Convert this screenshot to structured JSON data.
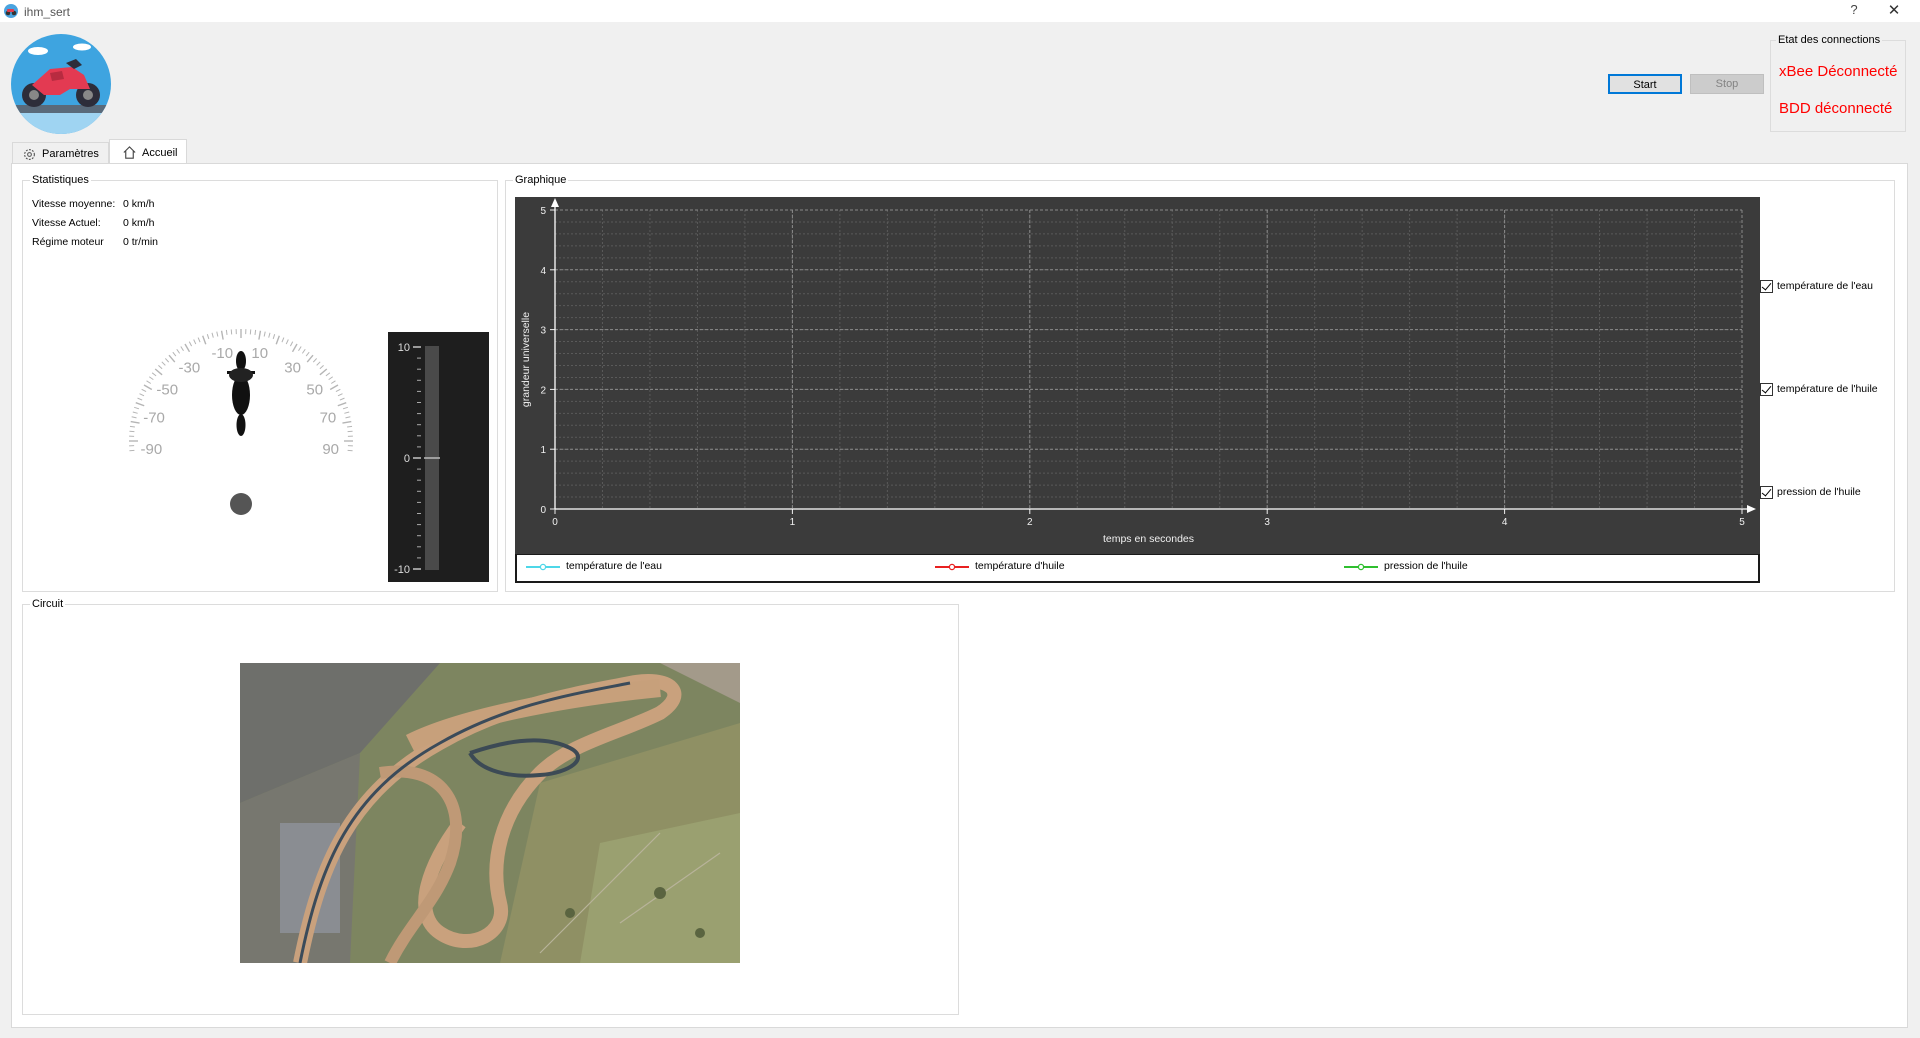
{
  "window": {
    "title": "ihm_sert",
    "help_glyph": "?",
    "close_glyph": "✕"
  },
  "toolbar": {
    "start_label": "Start",
    "stop_label": "Stop"
  },
  "connections": {
    "title": "Etat des connections",
    "xbee": "xBee Déconnecté",
    "bdd": "BDD déconnecté",
    "status_color": "#ff0000"
  },
  "tabs": [
    {
      "label": "Paramètres",
      "icon": "gear-icon",
      "active": false
    },
    {
      "label": "Accueil",
      "icon": "home-icon",
      "active": true
    }
  ],
  "stats": {
    "title": "Statistiques",
    "rows": [
      {
        "label": "Vitesse moyenne:",
        "value": "0 km/h"
      },
      {
        "label": "Vitesse Actuel:",
        "value": "0 km/h"
      },
      {
        "label": "Régime moteur",
        "value": "0 tr/min"
      }
    ]
  },
  "gauge": {
    "ticks": [
      "-90",
      "-70",
      "-50",
      "-30",
      "-10",
      "10",
      "30",
      "50",
      "70",
      "90"
    ],
    "value": 0,
    "icon": "motorcycle-icon"
  },
  "slider": {
    "ticks": [
      "10",
      "0",
      "-10"
    ],
    "value": 0,
    "min": -10,
    "max": 10
  },
  "graph": {
    "title": "Graphique",
    "checkboxes": [
      {
        "label": "température de l'eau",
        "checked": true
      },
      {
        "label": "température de l'huile",
        "checked": true
      },
      {
        "label": "pression de l'huile",
        "checked": true
      }
    ],
    "legend": [
      {
        "name": "température de l'eau",
        "color": "#4dd7e8"
      },
      {
        "name": "température d'huile",
        "color": "#e82020"
      },
      {
        "name": "pression de l'huile",
        "color": "#2fbf2f"
      }
    ]
  },
  "chart_data": {
    "type": "line",
    "xlabel": "temps en secondes",
    "ylabel": "grandeur universelle",
    "xlim": [
      0,
      5
    ],
    "ylim": [
      0,
      5
    ],
    "xticks": [
      "0",
      "1",
      "2",
      "3",
      "4",
      "5"
    ],
    "yticks": [
      "0",
      "1",
      "2",
      "3",
      "4",
      "5"
    ],
    "grid": true,
    "series": [
      {
        "name": "température de l'eau",
        "values": []
      },
      {
        "name": "température d'huile",
        "values": []
      },
      {
        "name": "pression de l'huile",
        "values": []
      }
    ]
  },
  "circuit": {
    "title": "Circuit",
    "image": "aerial-circuit-photo"
  }
}
